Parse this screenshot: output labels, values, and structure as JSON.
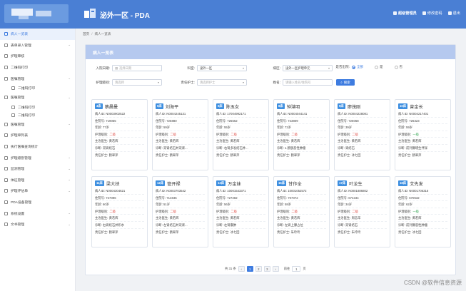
{
  "header": {
    "app_title": "泌外一区 - PDA",
    "user_name": "超级管理员",
    "change_password": "修改密码",
    "logout": "退出"
  },
  "sidebar": {
    "items": [
      {
        "label": "病人一览表",
        "active": true,
        "chevron": false
      },
      {
        "label": "表单录入管理",
        "active": false,
        "chevron": true
      },
      {
        "label": "护理审核",
        "active": false,
        "chevron": false
      },
      {
        "label": "二维码打印",
        "active": false,
        "chevron": false
      },
      {
        "label": "医嘱管理",
        "active": false,
        "chevron": true
      },
      {
        "label": "二维码打印",
        "active": false,
        "chevron": false
      },
      {
        "label": "医嘱管理",
        "active": false,
        "chevron": true
      },
      {
        "label": "二维码打印",
        "active": false,
        "chevron": false
      },
      {
        "label": "二维码打印",
        "active": false,
        "chevron": false
      },
      {
        "label": "医嘱管理",
        "active": false,
        "chevron": true
      },
      {
        "label": "护理单列表",
        "active": false,
        "chevron": false
      },
      {
        "label": "执行医嘱查询统计",
        "active": false,
        "chevron": false
      },
      {
        "label": "护理级别管理",
        "active": false,
        "chevron": true
      },
      {
        "label": "监测管理",
        "active": false,
        "chevron": true
      },
      {
        "label": "体征管理",
        "active": false,
        "chevron": true
      },
      {
        "label": "护理评估单",
        "active": false,
        "chevron": true
      },
      {
        "label": "PDA设备管理",
        "active": false,
        "chevron": false
      },
      {
        "label": "系统设置",
        "active": false,
        "chevron": true
      },
      {
        "label": "文书管理",
        "active": false,
        "chevron": true
      }
    ]
  },
  "breadcrumb": {
    "home": "首页",
    "sep": "/",
    "current": "病人一览表"
  },
  "panel": {
    "title": "病人一览表"
  },
  "filters": {
    "admission_date_label": "入院日期:",
    "admission_date_placeholder": "选择日期",
    "ward_label": "科室:",
    "ward_value": "泌外一区",
    "nurse_unit_label": "病区:",
    "nurse_unit_value": "泌外一区护理单元",
    "discharged_label": "是否出院:",
    "radio_all": "全部",
    "radio_yes": "是",
    "radio_no": "否",
    "care_level_label": "护理级别:",
    "care_level_placeholder": "请选择",
    "nurse_label": "责任护士:",
    "nurse_placeholder": "请选择护士",
    "name_label": "姓名:",
    "name_placeholder": "请输入姓名/住院号",
    "search_button": "搜索"
  },
  "patients": [
    {
      "bed": "4床",
      "name": "蔡晨曼",
      "id": "病人ID: N0003902522",
      "inpatient": "住院号: 719055",
      "age": "年龄: 77岁",
      "level_label": "护理级别:",
      "level": "二级",
      "level_color": "red",
      "doctor": "主治医生: 黄若辉",
      "diagnosis": "诊断: 双肾结石",
      "nurse": "责任护士: 鹤翠萍"
    },
    {
      "bed": "5床",
      "name": "刘海平",
      "id": "病人ID: N0004245131",
      "inpatient": "住院号: 725880",
      "age": "年龄: 59岁",
      "level_label": "护理级别:",
      "level": "二级",
      "level_color": "red",
      "doctor": "主治医生: 黄若辉",
      "diagnosis": "诊断: 双肾结石并双肾...",
      "nurse": "责任护士: 鹤翠萍"
    },
    {
      "bed": "6床",
      "name": "陈五女",
      "id": "病人ID: 17004992171",
      "inpatient": "住院号: 725562",
      "age": "年龄: 55岁",
      "level_label": "护理级别:",
      "level": "二级",
      "level_color": "red",
      "doctor": "主治医生: 黄若辉",
      "diagnosis": "诊断: 右肾多发结石并...",
      "nurse": "责任护士: 鹤翠萍"
    },
    {
      "bed": "8床",
      "name": "钟湛明",
      "id": "病人ID: N0004044141",
      "inpatient": "住院号: 723809",
      "age": "年龄: 72岁",
      "level_label": "护理级别:",
      "level": "二级",
      "level_color": "red",
      "doctor": "主治医生: 黄若辉",
      "diagnosis": "诊断: 1.膀胱恶性肿瘤",
      "nurse": "责任护士: 鹤翠萍"
    },
    {
      "bed": "9床",
      "name": "廖茂刚",
      "id": "病人ID: N0004228081",
      "inpatient": "住院号: 726068",
      "age": "年龄: 39岁",
      "level_label": "护理级别:",
      "level": "二级",
      "level_color": "red",
      "doctor": "主治医生: 黄若辉",
      "diagnosis": "诊断: 肾结石",
      "nurse": "责任护士: 冰七回"
    },
    {
      "bed": "10床",
      "name": "曾金长",
      "id": "病人ID: N0004217401",
      "inpatient": "住院号: 726323",
      "age": "年龄: 59岁",
      "level_label": "护理级别:",
      "level": "一级",
      "level_color": "green",
      "doctor": "主治医生: 黄若辉",
      "diagnosis": "诊断: 前列腺增生伴尿",
      "nurse": "责任护士: 鹤翠萍"
    },
    {
      "bed": "11床",
      "name": "梁大扶",
      "id": "病人ID: N0004304621",
      "inpatient": "住院号: 727096",
      "age": "年龄: 60岁",
      "level_label": "护理级别:",
      "level": "二级",
      "level_color": "red",
      "doctor": "主治医生: 黄若辉",
      "diagnosis": "诊断: 右肾结石并积水",
      "nurse": "责任护士: 鹤翠萍"
    },
    {
      "bed": "12床",
      "name": "管开禄",
      "id": "病人ID: N0003703542",
      "inpatient": "住院号: 714845",
      "age": "年龄: 51岁",
      "level_label": "护理级别:",
      "level": "二级",
      "level_color": "red",
      "doctor": "主治医生: 黄若辉",
      "diagnosis": "诊断: 左肾结石并双肾...",
      "nurse": "责任护士: 鹤翠萍"
    },
    {
      "bed": "13床",
      "name": "万金妹",
      "id": "病人ID: 10001543371",
      "inpatient": "住院号: 727282",
      "age": "年龄: 56岁",
      "level_label": "护理级别:",
      "level": "二级",
      "level_color": "red",
      "doctor": "主治医生: 黄若辉",
      "diagnosis": "诊断: 左肾囊肿",
      "nurse": "责任护士: 冰七回"
    },
    {
      "bed": "16床",
      "name": "甘作全",
      "id": "病人ID: 10001052572",
      "inpatient": "住院号: 707072",
      "age": "年龄: 58岁",
      "level_label": "护理级别:",
      "level": "二级",
      "level_color": "red",
      "doctor": "主治医生: 黄若辉",
      "diagnosis": "诊断: 左肾上腺占位",
      "nurse": "责任护士: 朱玲玲"
    },
    {
      "bed": "17床",
      "name": "叶龙生",
      "id": "病人ID: N0001886802",
      "inpatient": "住院号: 674344",
      "age": "年龄: 34岁",
      "level_label": "护理级别:",
      "level": "二级",
      "level_color": "red",
      "doctor": "主治医生: 周志华",
      "diagnosis": "诊断: 双肾结石",
      "nurse": "责任护士: 朱玲玲"
    },
    {
      "bed": "18床",
      "name": "艾先发",
      "id": "病人ID: N0001706316",
      "inpatient": "住院号: 670632",
      "age": "年龄: 62岁",
      "level_label": "护理级别:",
      "level": "一级",
      "level_color": "green",
      "doctor": "主治医生: 黄若辉",
      "diagnosis": "诊断: 前列腺恶性肿瘤",
      "nurse": "责任护士: 冰七回"
    }
  ],
  "pagination": {
    "total": "共 31 条",
    "prev": "‹",
    "pages": [
      "1",
      "2",
      "3"
    ],
    "current_page": "1",
    "next": "›",
    "goto_label": "前往",
    "goto_value": "1",
    "page_unit": "页"
  },
  "watermark": "CSDN @软件信息资源",
  "colors": {
    "header": "#4a7fd4",
    "panel_title": "#b5c9ef",
    "accent": "#3e7ce0",
    "level_red": "#e0504a",
    "level_green": "#3aa757"
  }
}
